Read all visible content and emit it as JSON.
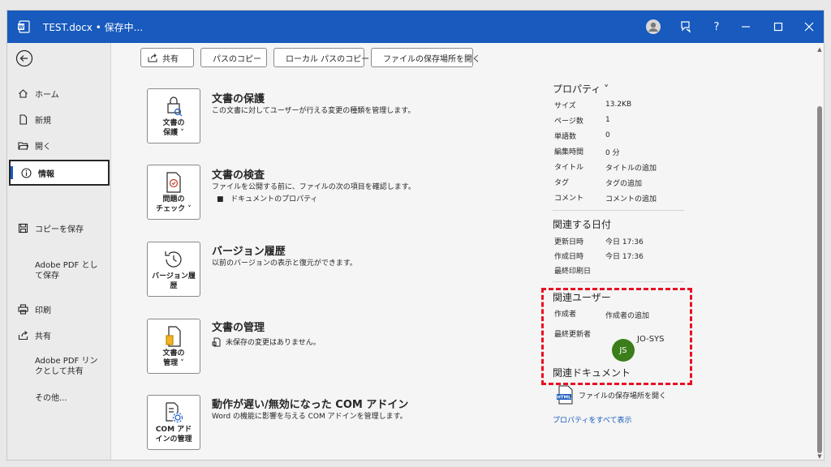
{
  "window": {
    "title": "TEST.docx • 保存中...",
    "accent": "#185abd"
  },
  "sidebar": {
    "items": [
      {
        "label": "ホーム",
        "icon": "home-icon"
      },
      {
        "label": "新規",
        "icon": "new-document-icon"
      },
      {
        "label": "開く",
        "icon": "folder-open-icon"
      },
      {
        "label": "情報",
        "icon": "info-icon",
        "active": true
      },
      {
        "label": "コピーを保存",
        "icon": "save-copy-icon"
      },
      {
        "label": "Adobe PDF として保存"
      },
      {
        "label": "印刷",
        "icon": "printer-icon"
      },
      {
        "label": "共有",
        "icon": "share-icon"
      },
      {
        "label": "Adobe PDF リンクとして共有"
      },
      {
        "label": "その他..."
      }
    ]
  },
  "toolbar": {
    "share": "共有",
    "copy_path": "パスのコピー",
    "copy_local_path": "ローカル パスのコピー",
    "open_location": "ファイルの保存場所を開く"
  },
  "sections": [
    {
      "tile": "文書の\n保護 ˅",
      "title": "文書の保護",
      "desc": "この文書に対してユーザーが行える変更の種類を管理します。"
    },
    {
      "tile": "問題の\nチェック ˅",
      "title": "文書の検査",
      "desc": "ファイルを公開する前に、ファイルの次の項目を確認します。",
      "bullet": "ドキュメントのプロパティ"
    },
    {
      "tile": "バージョン履\n歴",
      "title": "バージョン履歴",
      "desc": "以前のバージョンの表示と復元ができます。"
    },
    {
      "tile": "文書の\n管理 ˅",
      "title": "文書の管理",
      "desc": "未保存の変更はありません。"
    },
    {
      "tile": "COM アド\nインの管理",
      "title": "動作が遅い/無効になった COM アドイン",
      "desc": "Word の機能に影響を与える COM アドインを管理します。"
    }
  ],
  "properties": {
    "heading": "プロパティ ˅",
    "rows": [
      {
        "label": "サイズ",
        "value": "13.2KB"
      },
      {
        "label": "ページ数",
        "value": "1"
      },
      {
        "label": "単語数",
        "value": "0"
      },
      {
        "label": "編集時間",
        "value": "0 分"
      },
      {
        "label": "タイトル",
        "value": "タイトルの追加"
      },
      {
        "label": "タグ",
        "value": "タグの追加"
      },
      {
        "label": "コメント",
        "value": "コメントの追加"
      }
    ]
  },
  "dates": {
    "heading": "関連する日付",
    "rows": [
      {
        "label": "更新日時",
        "value": "今日 17:36"
      },
      {
        "label": "作成日時",
        "value": "今日 17:36"
      },
      {
        "label": "最終印刷日",
        "value": ""
      }
    ]
  },
  "people": {
    "heading": "関連ユーザー",
    "author_label": "作成者",
    "author_value": "作成者の追加",
    "modified_label": "最終更新者",
    "avatar_initials": "JS",
    "modified_value": "JO-SYS"
  },
  "docs": {
    "heading": "関連ドキュメント",
    "open_location": "ファイルの保存場所を開く",
    "show_all": "プロパティをすべて表示"
  }
}
